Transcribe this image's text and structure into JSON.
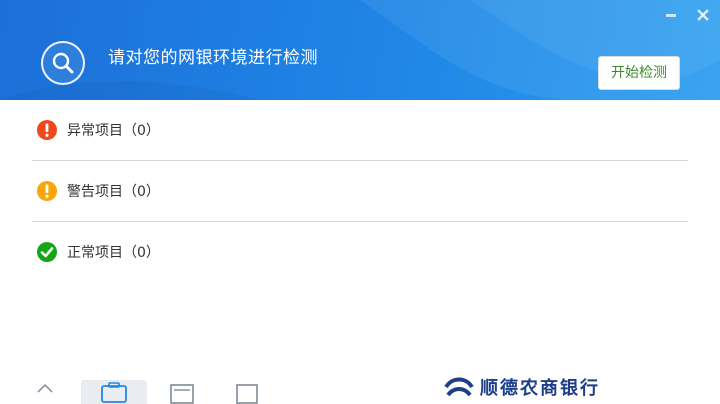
{
  "header": {
    "title": "请对您的网银环境进行检测",
    "start_button": "开始检测",
    "icons": {
      "logo": "magnifier-icon",
      "minimize": "minimize-icon",
      "close": "close-icon"
    },
    "colors": {
      "gradient_start": "#1d6fd8",
      "gradient_end": "#2a9df0",
      "button_text": "#3a8d2a"
    }
  },
  "categories": [
    {
      "label": "异常项目（0）",
      "icon": "error-exclamation-icon",
      "color": "#f0481d"
    },
    {
      "label": "警告项目（0）",
      "icon": "warning-exclamation-icon",
      "color": "#f7a60c"
    },
    {
      "label": "正常项目（0）",
      "icon": "ok-check-icon",
      "color": "#16a516"
    }
  ],
  "footer": {
    "bank_name": "顺德农商银行",
    "nav_icons": [
      "home-icon",
      "toolbox-icon",
      "window-icon",
      "square-icon"
    ]
  }
}
